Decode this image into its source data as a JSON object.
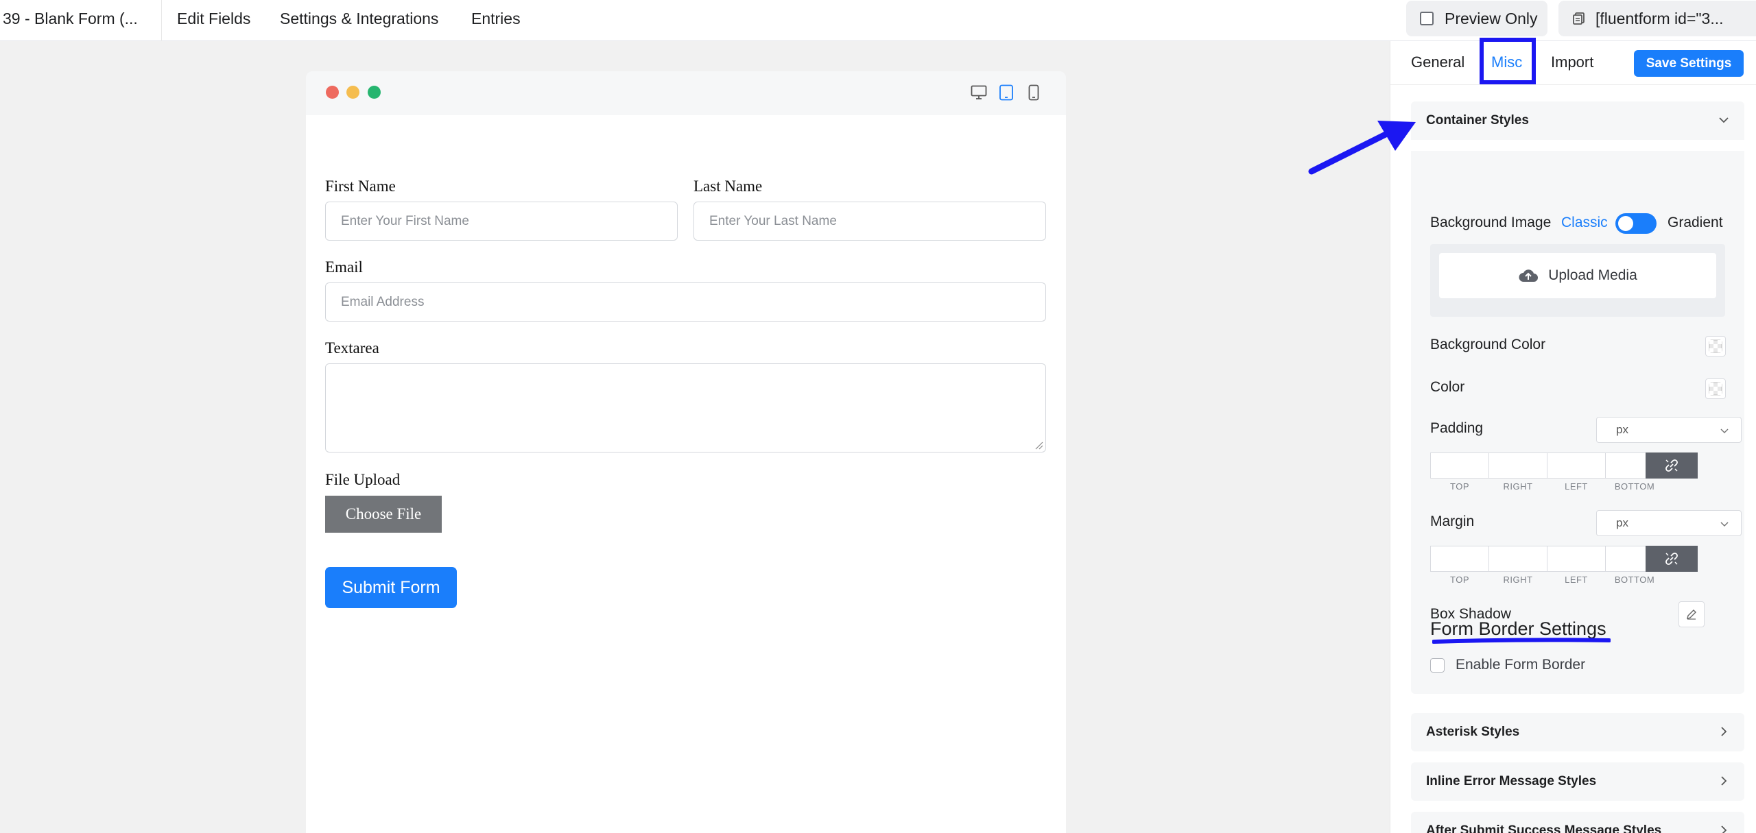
{
  "topbar": {
    "title": "39 - Blank Form (...",
    "nav": [
      "Edit Fields",
      "Settings & Integrations",
      "Entries"
    ],
    "preview_label": "Preview Only",
    "shortcode_label": "[fluentform id=\"3..."
  },
  "form": {
    "first_name_label": "First Name",
    "first_name_placeholder": "Enter Your First Name",
    "last_name_label": "Last Name",
    "last_name_placeholder": "Enter Your Last Name",
    "email_label": "Email",
    "email_placeholder": "Email Address",
    "textarea_label": "Textarea",
    "file_upload_label": "File Upload",
    "choose_file_label": "Choose File",
    "submit_label": "Submit Form"
  },
  "panel": {
    "tabs": [
      "General",
      "Misc",
      "Import"
    ],
    "active_tab": "Misc",
    "save_label": "Save Settings",
    "container_styles": {
      "title": "Container Styles",
      "background_image_label": "Background Image",
      "classic_label": "Classic",
      "gradient_label": "Gradient",
      "upload_label": "Upload Media",
      "background_color_label": "Background Color",
      "color_label": "Color",
      "padding_label": "Padding",
      "padding_unit": "px",
      "margin_label": "Margin",
      "margin_unit": "px",
      "side_labels": [
        "TOP",
        "RIGHT",
        "LEFT",
        "BOTTOM"
      ],
      "box_shadow_label": "Box Shadow",
      "form_border_title": "Form Border Settings",
      "enable_border_label": "Enable Form Border"
    },
    "other_sections": [
      "Asterisk Styles",
      "Inline Error Message Styles",
      "After Submit Success Message Styles"
    ]
  },
  "colors": {
    "accent": "#1a7efb",
    "annotation": "#1b17f2",
    "dot_red": "#ee6a5f",
    "dot_yellow": "#f5bd4f",
    "dot_green": "#26b56f"
  },
  "icons": [
    "checkbox-icon",
    "copy-icon",
    "desktop-icon",
    "tablet-icon",
    "mobile-icon",
    "chevron-down-icon",
    "chevron-right-icon",
    "upload-cloud-icon",
    "unlink-icon",
    "pencil-icon",
    "arrow-annotation"
  ]
}
